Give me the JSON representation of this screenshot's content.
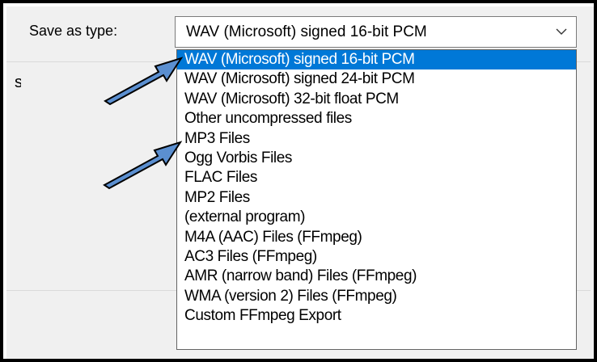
{
  "save_type": {
    "label": "Save as type:",
    "selected_value": "WAV (Microsoft) signed 16-bit PCM",
    "options": [
      "WAV (Microsoft) signed 16-bit PCM",
      "WAV (Microsoft) signed 24-bit PCM",
      "WAV (Microsoft) 32-bit float PCM",
      "Other uncompressed files",
      "MP3 Files",
      "Ogg Vorbis Files",
      "FLAC Files",
      "MP2 Files",
      "(external program)",
      "M4A (AAC) Files (FFmpeg)",
      "AC3 Files (FFmpeg)",
      "AMR (narrow band) Files (FFmpeg)",
      "WMA (version 2) Files (FFmpeg)",
      "Custom FFmpeg Export"
    ],
    "highlighted_index": 0,
    "chevron_icon": "chevron-down-icon"
  },
  "background": {
    "partial_text": "s"
  },
  "annotations": {
    "arrow_icon": "callout-arrow-icon",
    "arrow_color": "#5b8fd0",
    "arrow_outline": "#000000"
  },
  "colors": {
    "selection": "#0078d7",
    "dialog_background": "#f0f0f0",
    "frame_border": "#000000"
  }
}
